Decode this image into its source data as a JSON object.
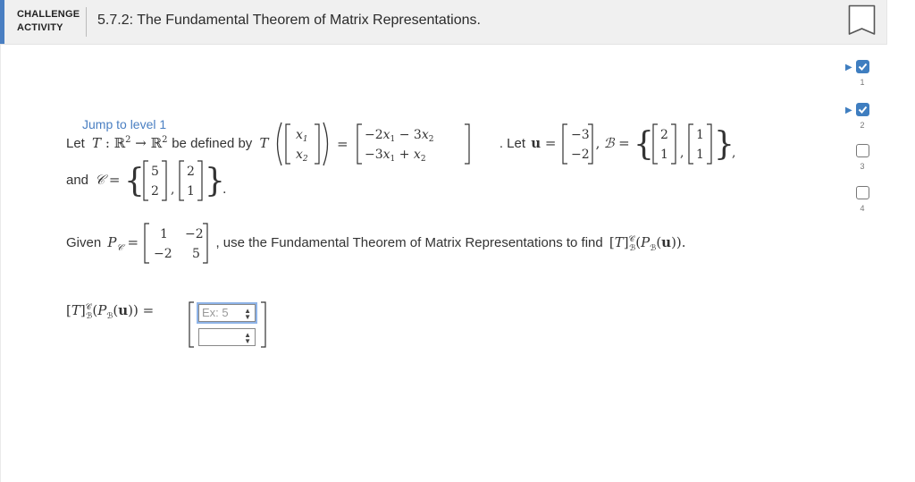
{
  "header": {
    "label_line1": "CHALLENGE",
    "label_line2": "ACTIVITY",
    "title": "5.7.2: The Fundamental Theorem of Matrix Representations."
  },
  "jump": {
    "text": "Jump to level 1"
  },
  "problem": {
    "let_text": "Let",
    "be_defined": "be defined by",
    "let_u": ". Let",
    "and_text": "and",
    "given_text": "Given",
    "use_text": ", use the Fundamental Theorem of Matrix Representations to find"
  },
  "answer": {
    "placeholder1": "Ex: 5",
    "placeholder2": ""
  },
  "levels": [
    {
      "num": "1",
      "state": "done"
    },
    {
      "num": "2",
      "state": "done"
    },
    {
      "num": "3",
      "state": "todo"
    },
    {
      "num": "4",
      "state": "todo"
    }
  ],
  "colors": {
    "accent": "#3f7ec0",
    "link": "#4a7fc2"
  }
}
